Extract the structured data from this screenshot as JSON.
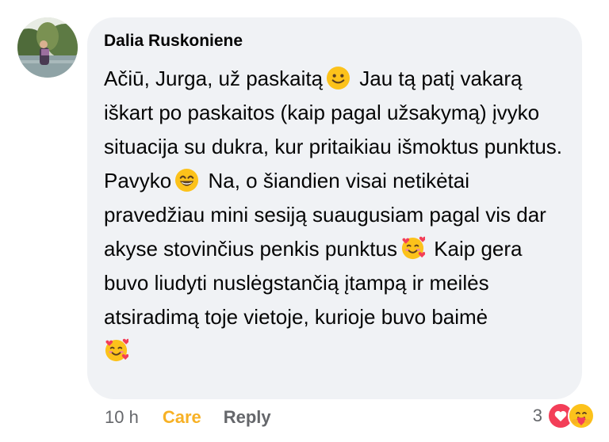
{
  "comment": {
    "author": "Dalia Ruskoniene",
    "segments": [
      "Ačiū, Jurga, už paskaitą",
      "Jau tą patį vakarą iškart po paskaitos (kaip pagal užsakymą) įvyko situacija su dukra, kur pritaikiau išmoktus punktus. Pavyko",
      "Na, o šiandien visai netikėtai pravedžiau mini sesiją suaugusiam pagal vis dar akyse stovinčius penkis punktus",
      "Kaip gera buvo liudyti nuslėgstančią įtampą ir meilės atsiradimą toje vietoje, kurioje buvo baimė"
    ],
    "emojis": [
      "slightly-smiling-face",
      "grinning-face-with-smiling-eyes",
      "smiling-face-with-hearts",
      "smiling-face-with-hearts"
    ]
  },
  "actions": {
    "time": "10 h",
    "care_label": "Care",
    "reply_label": "Reply"
  },
  "reactions": {
    "count": "3",
    "icons": [
      "heart-reaction",
      "care-reaction"
    ]
  },
  "colors": {
    "bubble": "#f0f2f5",
    "care": "#f7b125",
    "meta": "#65676b",
    "heart": "#f33e58"
  }
}
